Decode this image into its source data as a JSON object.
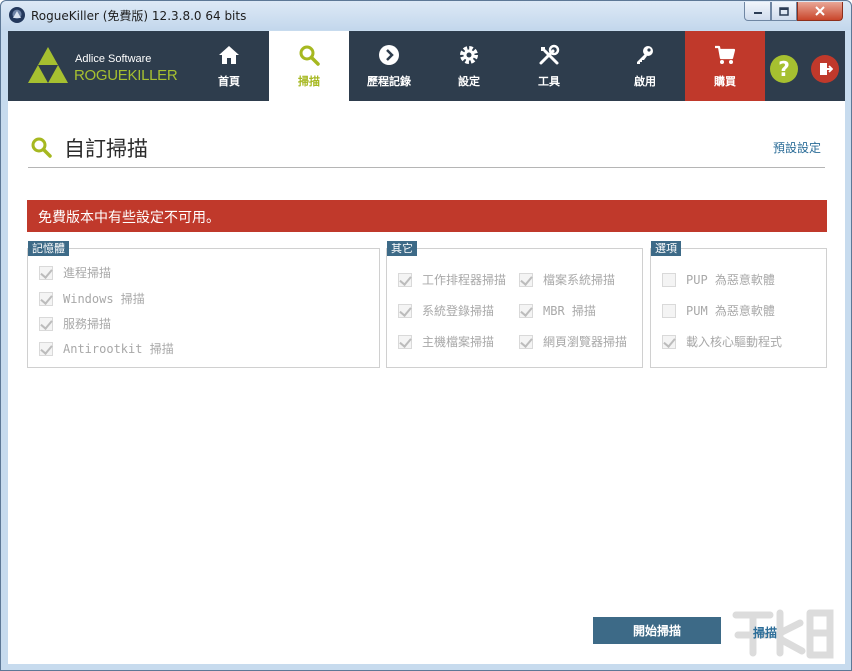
{
  "window": {
    "title": "RogueKiller (免費版) 12.3.8.0 64 bits"
  },
  "logo": {
    "line1": "Adlice Software",
    "line2": "ROGUEKILLER"
  },
  "nav": {
    "items": [
      {
        "label": "首頁",
        "icon": "home-icon"
      },
      {
        "label": "掃描",
        "icon": "search-icon"
      },
      {
        "label": "歷程記錄",
        "icon": "chevron-right-icon"
      },
      {
        "label": "設定",
        "icon": "gear-icon"
      },
      {
        "label": "工具",
        "icon": "tools-icon"
      },
      {
        "label": "啟用",
        "icon": "key-icon"
      },
      {
        "label": "購買",
        "icon": "cart-icon"
      }
    ],
    "active": "掃描",
    "help_label": "?",
    "accent": "#a6c030",
    "buy_color": "#c0392b",
    "header_bg": "#2e3d4d"
  },
  "page": {
    "title": "自訂掃描",
    "default_settings_link": "預設設定",
    "warning": "免費版本中有些設定不可用。"
  },
  "groups": {
    "memory": {
      "title": "記憶體",
      "options": [
        {
          "label": "進程掃描",
          "checked": true
        },
        {
          "label": "Windows 掃描",
          "checked": true
        },
        {
          "label": "服務掃描",
          "checked": true
        },
        {
          "label": "Antirootkit 掃描",
          "checked": true
        }
      ]
    },
    "other": {
      "title": "其它",
      "options": [
        {
          "label": "工作排程器掃描",
          "checked": true
        },
        {
          "label": "檔案系統掃描",
          "checked": true
        },
        {
          "label": "系統登錄掃描",
          "checked": true
        },
        {
          "label": "MBR 掃描",
          "checked": true
        },
        {
          "label": "主機檔案掃描",
          "checked": true
        },
        {
          "label": "網頁瀏覽器掃描",
          "checked": true
        }
      ]
    },
    "options": {
      "title": "選項",
      "options": [
        {
          "label": "PUP 為惡意軟體",
          "checked": false
        },
        {
          "label": "PUM 為惡意軟體",
          "checked": false
        },
        {
          "label": "載入核心驅動程式",
          "checked": true
        }
      ]
    }
  },
  "actions": {
    "start_scan": "開始掃描",
    "scan": "掃描"
  }
}
